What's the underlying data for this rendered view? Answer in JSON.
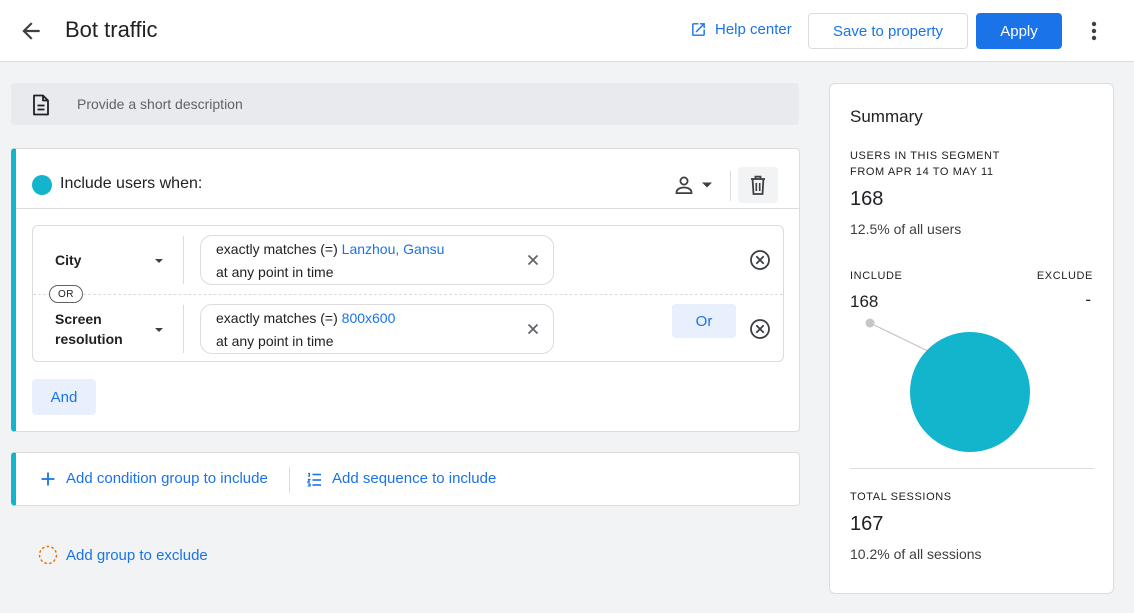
{
  "header": {
    "title": "Bot traffic",
    "help_label": "Help center",
    "save_label": "Save to property",
    "apply_label": "Apply"
  },
  "description": {
    "placeholder": "Provide a short description",
    "value": ""
  },
  "include_group": {
    "title": "Include users when:",
    "scope_icon": "person-icon",
    "conditions": [
      {
        "dimension": "City",
        "operator": "exactly matches (=)",
        "value": "Lanzhou, Gansu",
        "timing": "at any point in time"
      },
      {
        "dimension": "Screen resolution",
        "operator": "exactly matches (=)",
        "value": "800x600",
        "timing": "at any point in time"
      }
    ],
    "or_separator": "OR",
    "or_button_label": "Or",
    "and_button_label": "And"
  },
  "add_actions": {
    "add_condition_group": "Add condition group to include",
    "add_sequence": "Add sequence to include",
    "add_exclude_group": "Add group to exclude"
  },
  "summary": {
    "title": "Summary",
    "users_label_line1": "USERS IN THIS SEGMENT",
    "users_label_line2": "FROM APR 14 TO MAY 11",
    "users_value": "168",
    "users_pct": "12.5% of all users",
    "include_label": "INCLUDE",
    "exclude_label": "EXCLUDE",
    "include_value": "168",
    "exclude_value": "-",
    "sessions_label": "TOTAL SESSIONS",
    "sessions_value": "167",
    "sessions_pct": "10.2% of all sessions"
  },
  "colors": {
    "accent": "#1a73e8",
    "include_teal": "#12b5cb",
    "chip_blue_bg": "#e8f0fe",
    "pie_leader_gray": "#c6c6c6"
  },
  "chart_data": {
    "type": "pie",
    "categories": [
      "Include",
      "Exclude"
    ],
    "values": [
      168,
      0
    ]
  }
}
